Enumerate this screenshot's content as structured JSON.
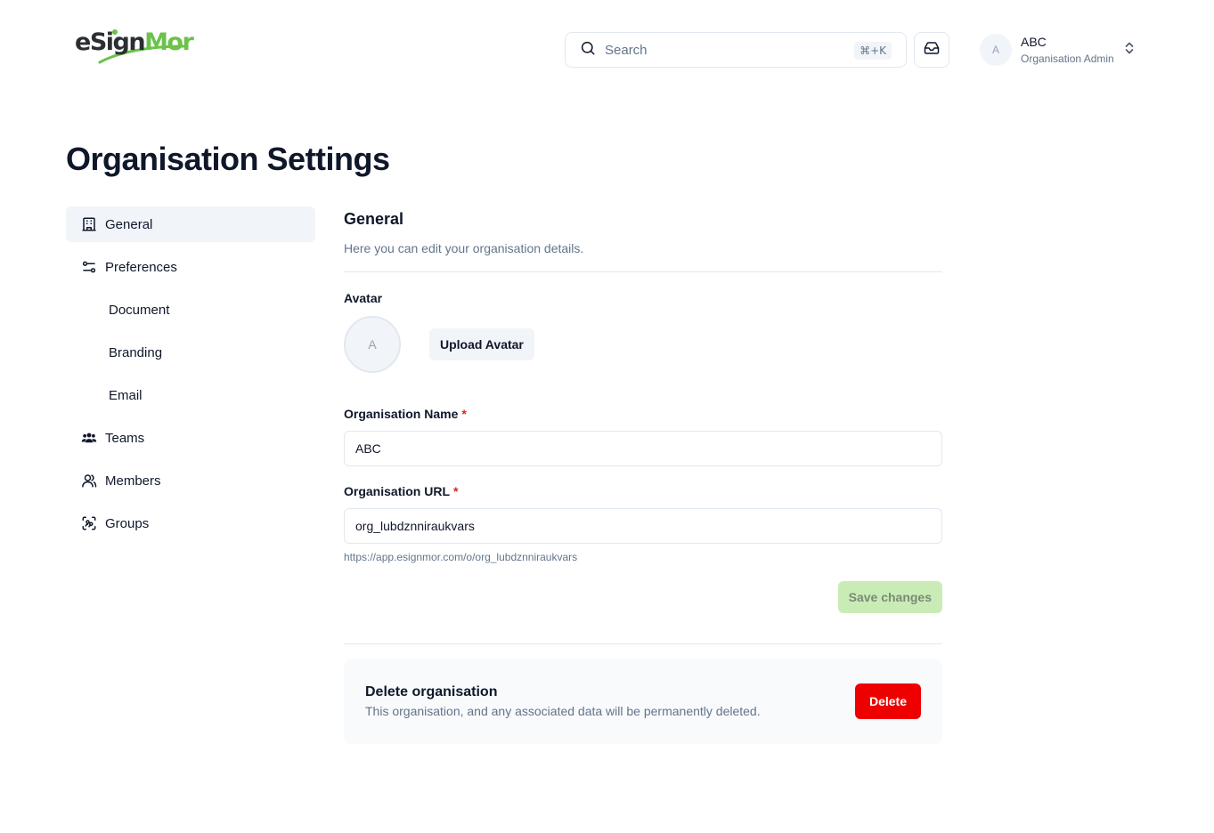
{
  "app": {
    "logo": {
      "part1": "e",
      "part2": "Sign",
      "part3": "Mor"
    }
  },
  "header": {
    "search_placeholder": "Search",
    "search_shortcut": "⌘+K",
    "user": {
      "initial": "A",
      "name": "ABC",
      "role": "Organisation Admin"
    }
  },
  "page": {
    "title": "Organisation Settings"
  },
  "sidebar": {
    "items": [
      {
        "label": "General",
        "icon": "building-icon",
        "active": true
      },
      {
        "label": "Preferences",
        "icon": "sliders-icon"
      },
      {
        "label": "Document",
        "sub": true
      },
      {
        "label": "Branding",
        "sub": true
      },
      {
        "label": "Email",
        "sub": true
      },
      {
        "label": "Teams",
        "icon": "users-icon"
      },
      {
        "label": "Members",
        "icon": "user-icon"
      },
      {
        "label": "Groups",
        "icon": "group-scan-icon"
      }
    ]
  },
  "general": {
    "title": "General",
    "description": "Here you can edit your organisation details.",
    "avatar_label": "Avatar",
    "avatar_initial": "A",
    "upload_label": "Upload Avatar",
    "name_label": "Organisation Name",
    "name_value": "ABC",
    "url_label": "Organisation URL",
    "url_value": "org_lubdznniraukvars",
    "url_hint": "https://app.esignmor.com/o/org_lubdznniraukvars",
    "required_mark": "*",
    "save_label": "Save changes"
  },
  "danger": {
    "title": "Delete organisation",
    "description": "This organisation, and any associated data will be permanently deleted.",
    "delete_label": "Delete"
  },
  "colors": {
    "brand_green": "#6cc24a",
    "danger_red": "#ef0000",
    "save_disabled": "#c9ecb6"
  }
}
